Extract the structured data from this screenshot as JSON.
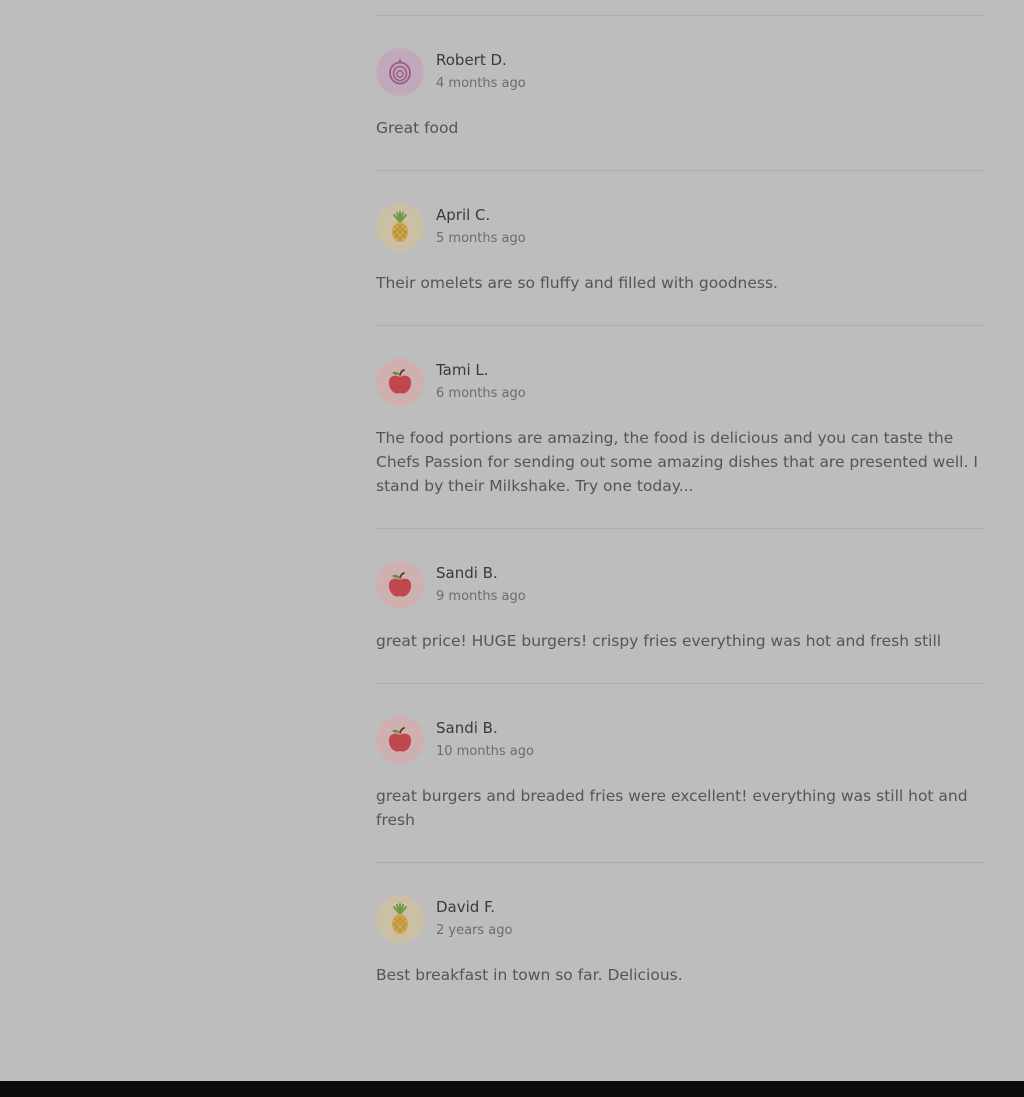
{
  "reviews": [
    {
      "name": "Robert D.",
      "time": "4 months ago",
      "text": "Great food",
      "avatar_icon": "onion-icon"
    },
    {
      "name": "April C.",
      "time": "5 months ago",
      "text": "Their omelets are so fluffy and filled with goodness.",
      "avatar_icon": "pineapple-icon"
    },
    {
      "name": "Tami L.",
      "time": "6 months ago",
      "text": "The food portions are amazing, the food is delicious and you can taste the Chefs Passion for sending out some amazing dishes that are presented well. I stand by their Milkshake. Try one today...",
      "avatar_icon": "apple-icon"
    },
    {
      "name": "Sandi B.",
      "time": "9 months ago",
      "text": "great price! HUGE burgers! crispy fries everything was hot and fresh still",
      "avatar_icon": "apple-icon"
    },
    {
      "name": "Sandi B.",
      "time": "10 months ago",
      "text": "great burgers and breaded fries were excellent! everything was still hot and fresh",
      "avatar_icon": "apple-icon"
    },
    {
      "name": "David F.",
      "time": "2 years ago",
      "text": "Best breakfast in town so far. Delicious.",
      "avatar_icon": "pineapple-icon"
    }
  ],
  "colors": {
    "background": "#bdbdbd",
    "footer": "#0b0b0b",
    "onion": "#9b5b8a",
    "pineapple": "#d1a94f",
    "apple": "#c0474b"
  }
}
